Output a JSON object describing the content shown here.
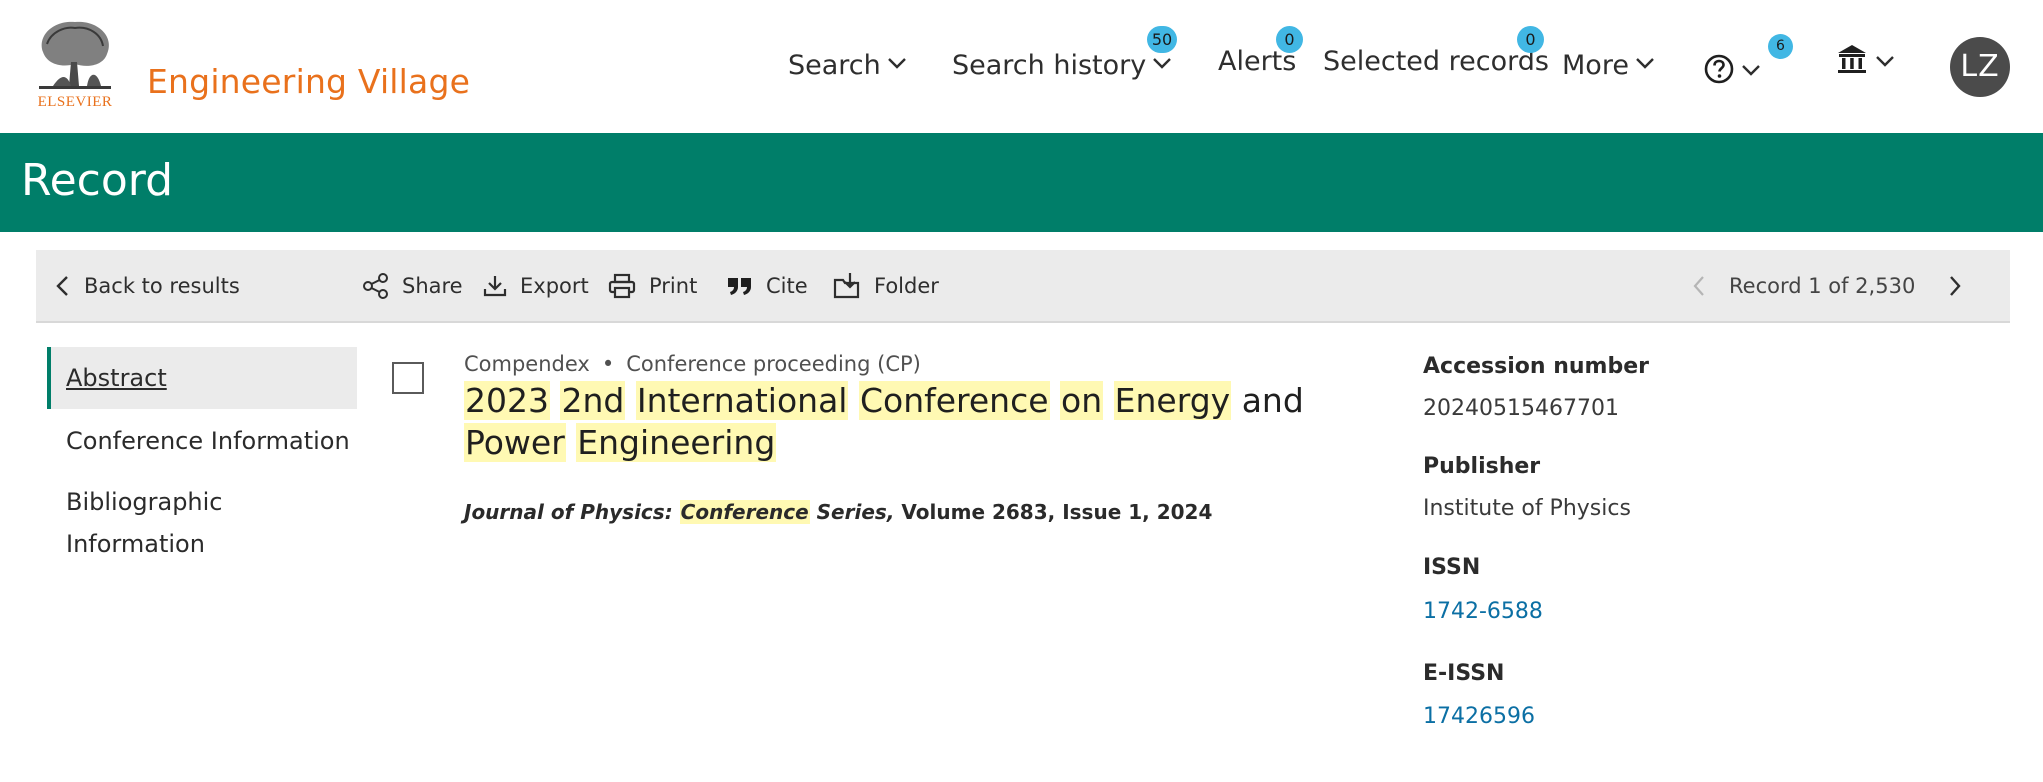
{
  "header": {
    "brand": "Engineering Village",
    "logo_text": "ELSEVIER",
    "nav": {
      "search": "Search",
      "search_history": "Search history",
      "search_history_count": "50",
      "alerts": "Alerts",
      "alerts_count": "0",
      "selected_records": "Selected records",
      "selected_records_count": "0",
      "more": "More",
      "help_count": "6"
    },
    "avatar_initials": "LZ"
  },
  "band": {
    "title": "Record"
  },
  "toolbar": {
    "back": "Back to results",
    "share": "Share",
    "export": "Export",
    "print": "Print",
    "cite": "Cite",
    "folder": "Folder",
    "record_position": "Record 1 of 2,530"
  },
  "sidebar": {
    "items": [
      {
        "label": "Abstract",
        "active": true
      },
      {
        "label": "Conference Information"
      },
      {
        "label": "Bibliographic Information"
      }
    ]
  },
  "record": {
    "database": "Compendex",
    "separator": "•",
    "doc_type": "Conference proceeding (CP)",
    "title_words": [
      "2023",
      "2nd",
      "International",
      "Conference",
      "on",
      "Energy",
      "and",
      "Power",
      "Engineering"
    ],
    "source": {
      "journal_part1": "Journal of Physics:",
      "journal_highlight": "Conference",
      "journal_part2": "Series,",
      "volume_issue_year": "Volume 2683, Issue 1, 2024"
    }
  },
  "details": {
    "accession_label": "Accession number",
    "accession_value": "20240515467701",
    "publisher_label": "Publisher",
    "publisher_value": "Institute of Physics",
    "issn_label": "ISSN",
    "issn_value": "1742-6588",
    "eissn_label": "E-ISSN",
    "eissn_value": "17426596"
  },
  "colors": {
    "brand_orange": "#e9711c",
    "band_green": "#007e69",
    "badge_blue": "#41b7e4",
    "highlight_yellow": "#fff9b3",
    "link_blue": "#0b6fa4"
  },
  "icons": [
    "elsevier-tree-logo",
    "chevron-down-icon",
    "help-icon",
    "institution-icon",
    "chevron-left-icon",
    "share-icon",
    "export-icon",
    "print-icon",
    "cite-icon",
    "folder-icon",
    "chevron-right-icon"
  ]
}
